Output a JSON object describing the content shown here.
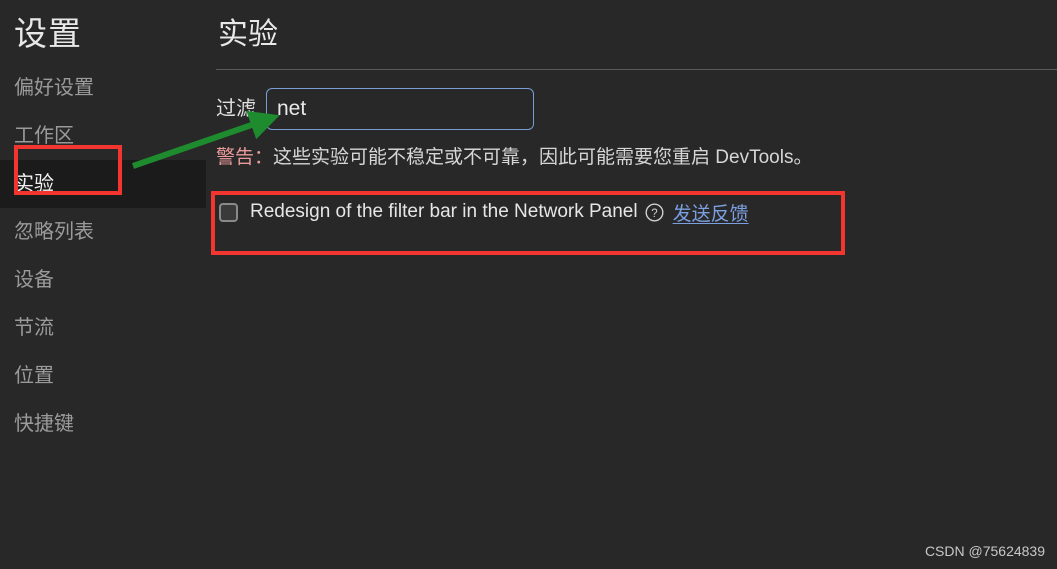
{
  "window": {
    "background_color": "#282828"
  },
  "sidebar": {
    "title": "设置",
    "items": [
      {
        "label": "偏好设置",
        "selected": false
      },
      {
        "label": "工作区",
        "selected": false
      },
      {
        "label": "实验",
        "selected": true
      },
      {
        "label": "忽略列表",
        "selected": false
      },
      {
        "label": "设备",
        "selected": false
      },
      {
        "label": "节流",
        "selected": false
      },
      {
        "label": "位置",
        "selected": false
      },
      {
        "label": "快捷键",
        "selected": false
      }
    ]
  },
  "content": {
    "title": "实验",
    "filter": {
      "label": "过滤",
      "value": "net",
      "placeholder": "",
      "focus_border_color": "#7a9ed4"
    },
    "warning": {
      "label": "警告：",
      "text": "这些实验可能不稳定或不可靠，因此可能需要您重启 DevTools。",
      "label_color": "#e99b9b"
    },
    "experiments": [
      {
        "checked": false,
        "label": "Redesign of the filter bar in the Network Panel",
        "help_icon": "question-circle-icon",
        "feedback_link": "发送反馈",
        "link_color": "#7b9fe0"
      }
    ]
  },
  "annotations": {
    "highlight_color": "#f2352f",
    "arrow_color": "#1e8b2e",
    "boxes": [
      {
        "name": "sidebar-experiments-highlight"
      },
      {
        "name": "experiment-row-highlight"
      }
    ],
    "arrow": {
      "name": "filter-input-arrow"
    }
  },
  "watermark": {
    "text": "CSDN @75624839"
  }
}
